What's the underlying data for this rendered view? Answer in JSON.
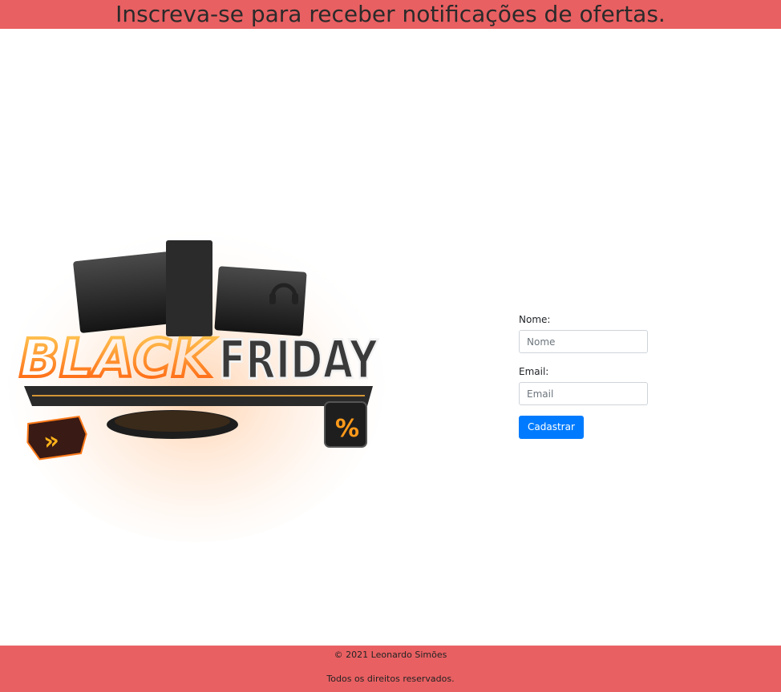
{
  "header": {
    "title": "Inscreva-se para receber notificações de ofertas."
  },
  "hero": {
    "image_text_left": "BLACK",
    "image_text_right": "FRIDAY",
    "badge_arrows": "»",
    "badge_percent": "%"
  },
  "form": {
    "name_label": "Nome:",
    "name_placeholder": "Nome",
    "email_label": "Email:",
    "email_placeholder": "Email",
    "submit_label": "Cadastrar"
  },
  "footer": {
    "copyright": "© 2021 Leonardo Simões",
    "rights": "Todos os direitos reservados."
  },
  "colors": {
    "header_bg": "#e96062",
    "footer_bg": "#e96062",
    "button_bg": "#007bff",
    "neon_orange": "#ff8a1f",
    "neon_white": "#f2f2f2"
  }
}
